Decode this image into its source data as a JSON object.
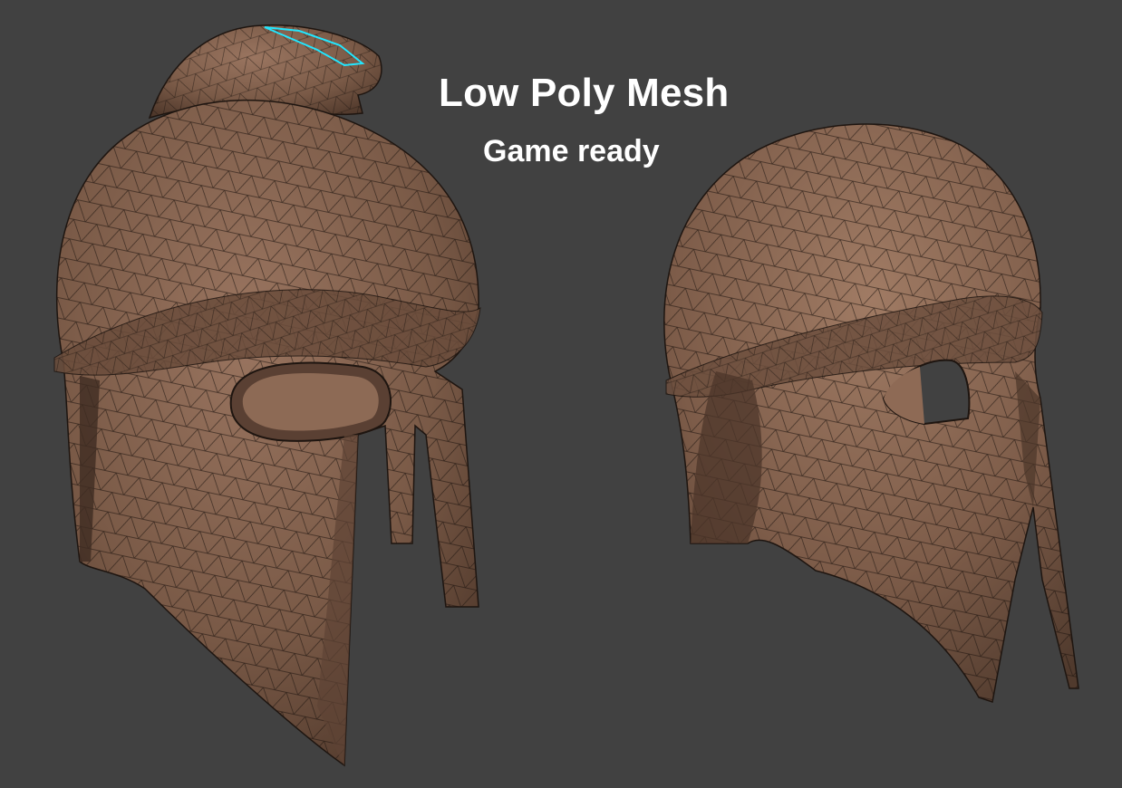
{
  "header": {
    "title": "Low Poly Mesh",
    "subtitle": "Game ready"
  },
  "scene": {
    "background_color": "#414141",
    "mesh_color": "#7a5a47",
    "mesh_shadow_color": "#4a3428",
    "wire_color": "#1e1510",
    "selection_color": "#22e6ff",
    "objects": [
      {
        "name": "helmet-three-quarter-view"
      },
      {
        "name": "helmet-side-view"
      }
    ]
  }
}
